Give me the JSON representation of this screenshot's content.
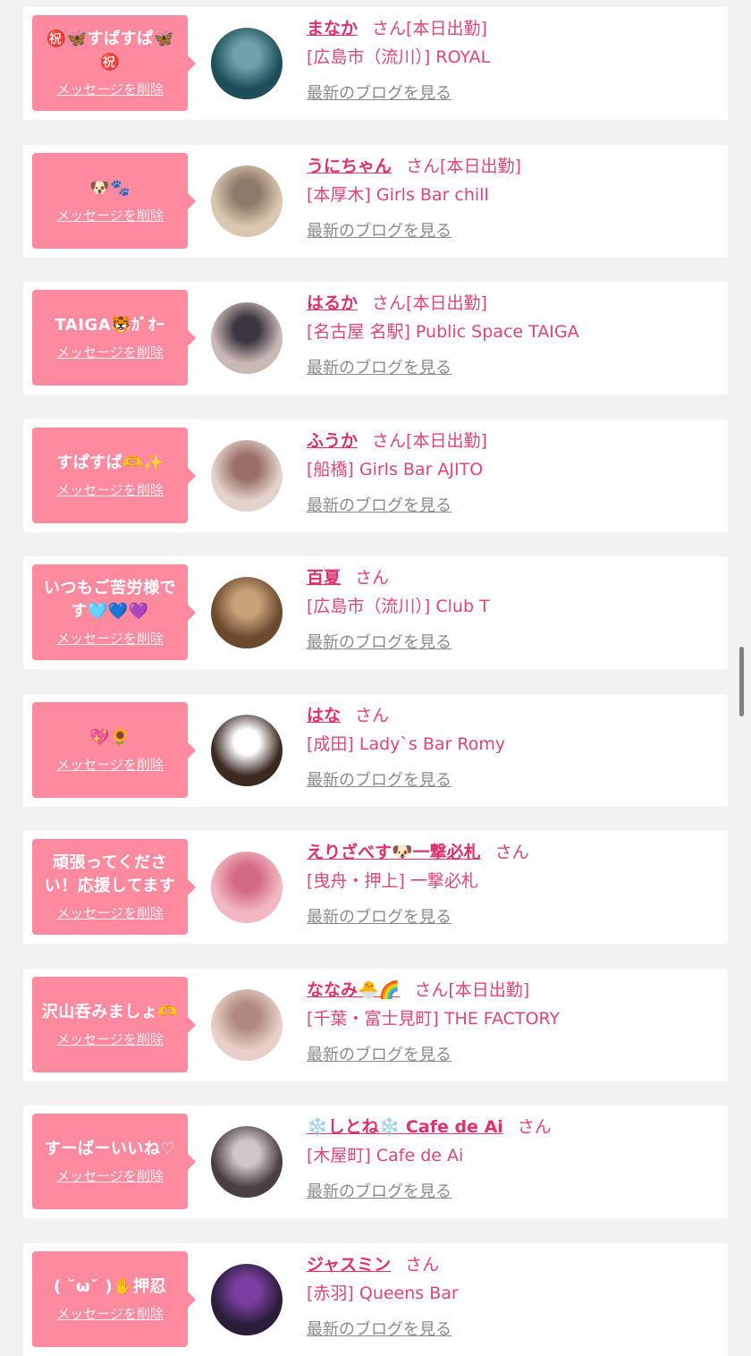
{
  "common": {
    "delete_label": "メッセージを削除",
    "blog_label": "最新のブログを見る"
  },
  "accent_color": "#e0306f",
  "bubble_color": "#fe8a9f",
  "cards": [
    {
      "message": "㊗️🦋すぱすぱ🦋㊗️",
      "name": "まなか",
      "honorific": "さん",
      "status": "[本日出勤]",
      "shop": "[広島市（流川）] ROYAL",
      "avatar_icon": "profile-photo"
    },
    {
      "message": "🐶🐾",
      "name": "うにちゃん",
      "honorific": "さん",
      "status": "[本日出勤]",
      "shop": "[本厚木] Girls Bar chill",
      "avatar_icon": "profile-photo"
    },
    {
      "message": "TAIGA🐯ｶﾞｵｰ",
      "name": "はるか",
      "honorific": "さん",
      "status": "[本日出勤]",
      "shop": "[名古屋 名駅] Public Space TAIGA",
      "avatar_icon": "profile-photo"
    },
    {
      "message": "すぱすぱ🫶✨",
      "name": "ふうか",
      "honorific": "さん",
      "status": "[本日出勤]",
      "shop": "[船橋] Girls Bar AJITO",
      "avatar_icon": "profile-photo"
    },
    {
      "message": "いつもご苦労様です🩵💙💜",
      "name": "百夏",
      "honorific": "さん",
      "status": "",
      "shop": "[広島市（流川）] Club T",
      "avatar_icon": "profile-photo"
    },
    {
      "message": "💖🌻",
      "name": "はな",
      "honorific": "さん",
      "status": "",
      "shop": "[成田] Lady`s Bar Romy",
      "avatar_icon": "profile-photo"
    },
    {
      "message": "頑張ってください！応援してます",
      "name": "えりざべす🐶一撃必札",
      "honorific": "さん",
      "status": "",
      "shop": "[曳舟・押上] 一撃必札",
      "avatar_icon": "profile-photo"
    },
    {
      "message": "沢山呑みましょ🫶",
      "name": "ななみ🐣🌈",
      "honorific": "さん",
      "status": "[本日出勤]",
      "shop": "[千葉・富士見町] THE FACTORY",
      "avatar_icon": "profile-photo"
    },
    {
      "message": "すーぱーいいね♡",
      "name": "❄️しとね❄️ Cafe de Ai",
      "honorific": "さん",
      "status": "",
      "shop": "[木屋町] Cafe de Ai",
      "avatar_icon": "profile-photo"
    },
    {
      "message": "( ˘ω˘ )✋押忍",
      "name": "ジャスミン",
      "honorific": "さん",
      "status": "",
      "shop": "[赤羽] Queens Bar",
      "avatar_icon": "profile-photo"
    }
  ]
}
